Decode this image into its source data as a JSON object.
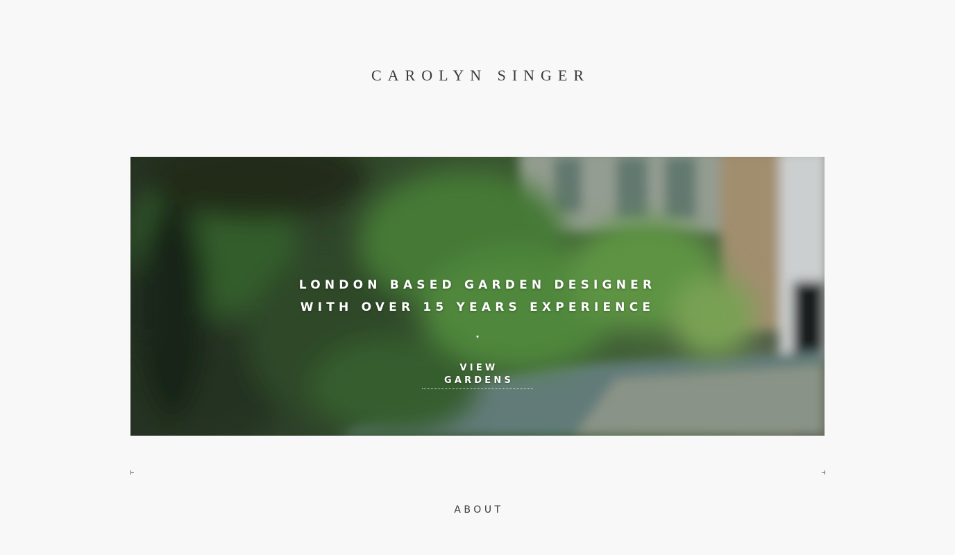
{
  "header": {
    "site_title": "CAROLYN SINGER"
  },
  "hero": {
    "line1": "LONDON BASED GARDEN DESIGNER",
    "line2": "WITH OVER 15 YEARS EXPERIENCE",
    "arrow_icon": "▾",
    "cta_label": "VIEW GARDENS"
  },
  "sections": {
    "about_heading": "ABOUT"
  },
  "colors": {
    "background": "#f8f8f8",
    "text": "#3a3a3a",
    "hero_text": "#ffffff",
    "foliage": "#3f7a3a"
  }
}
